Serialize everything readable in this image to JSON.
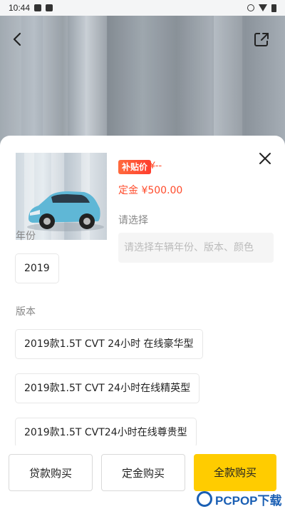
{
  "status_bar": {
    "time": "10:44"
  },
  "sheet": {
    "price_tag": "补贴价",
    "price_value": "¥--",
    "deposit_text": "定金 ¥500.00",
    "choose_label": "请选择",
    "choose_placeholder": "请选择车辆年份、版本、颜色",
    "year_label": "年份",
    "year_options": [
      "2019"
    ],
    "version_label": "版本",
    "version_options": [
      "2019款1.5T CVT 24小时 在线豪华型",
      "2019款1.5T CVT 24小时在线精英型",
      "2019款1.5T CVT24小时在线尊贵型"
    ]
  },
  "footer": {
    "loan_label": "贷款购买",
    "deposit_label": "定金购买",
    "full_label": "全款购买"
  },
  "watermark": {
    "text": "PCPOP下载"
  },
  "colors": {
    "accent": "#ffcc00",
    "price": "#ff4b2b"
  }
}
